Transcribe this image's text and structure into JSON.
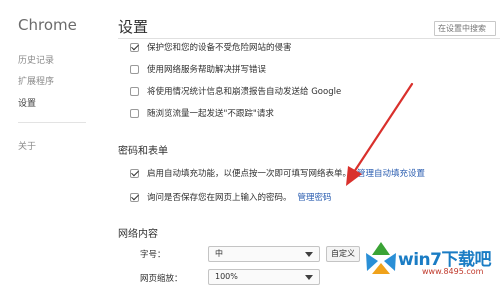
{
  "sidebar": {
    "brand": "Chrome",
    "items": [
      {
        "label": "历史记录"
      },
      {
        "label": "扩展程序"
      },
      {
        "label": "设置"
      },
      {
        "label": "关于"
      }
    ]
  },
  "header": {
    "title": "设置",
    "search_placeholder": "在设置中搜索"
  },
  "privacy_options": [
    {
      "label": "保护您和您的设备不受危险网站的侵害",
      "checked": true
    },
    {
      "label": "使用网络服务帮助解决拼写错误",
      "checked": false
    },
    {
      "label": "将使用情况统计信息和崩溃报告自动发送给 Google",
      "checked": false
    },
    {
      "label": "随浏览流量一起发送\"不跟踪\"请求",
      "checked": false
    }
  ],
  "passwords": {
    "section_title": "密码和表单",
    "autofill_label": "启用自动填充功能，以便点按一次即可填写网络表单。",
    "autofill_link": "管理自动填充设置",
    "save_label": "询问是否保存您在网页上输入的密码。",
    "save_link": "管理密码"
  },
  "web_content": {
    "section_title": "网络内容",
    "font_size_label": "字号：",
    "font_size_value": "中",
    "customize_button": "自定义字体...",
    "zoom_label": "网页缩放：",
    "zoom_value": "100%"
  },
  "watermark": {
    "text": "win7下载吧",
    "url": "www.8495.com"
  },
  "colors": {
    "link": "#2a5db0",
    "annotation_arrow": "#d9302c",
    "watermark_blue": "#1a7cc4"
  }
}
